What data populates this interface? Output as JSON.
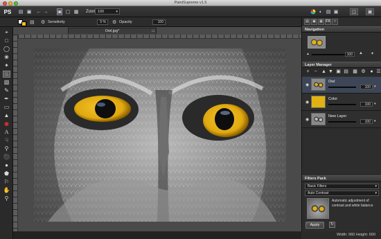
{
  "window": {
    "title": "PaintSupreme v1.5"
  },
  "app": {
    "logo": "PS"
  },
  "toolbar": {
    "zoom_label": "Zoom",
    "zoom_value": "100"
  },
  "options": {
    "sensitivity_label": "Sensitivity",
    "sensitivity_value": "5 %",
    "opacity_label": "Opacity",
    "opacity_value": "100",
    "primary_color": "#f0c020",
    "secondary_color": "#ffffff"
  },
  "document": {
    "tab_label": "Owl.jpg*"
  },
  "panels": {
    "navigator": {
      "title": "Navigation",
      "zoom_value": "100"
    },
    "layers": {
      "title": "Layer Manager",
      "items": [
        {
          "name": "Owl",
          "opacity": "100",
          "selected": true
        },
        {
          "name": "Color",
          "opacity": "100",
          "selected": false,
          "swatch": "#e1b212"
        },
        {
          "name": "New Layer",
          "opacity": "100",
          "selected": false
        }
      ]
    },
    "filters": {
      "title": "Filters Pack",
      "category": "Basic Filters",
      "filter": "Auto Contrast",
      "description": "Automatic adjustment of contrast and white balance",
      "apply_label": "Apply"
    }
  },
  "status": {
    "text": "Width: 960 Height: 600"
  },
  "colors": {
    "accent": "#e1b212",
    "panel_bg": "#2d2d2d",
    "selection": "#3c4656"
  }
}
